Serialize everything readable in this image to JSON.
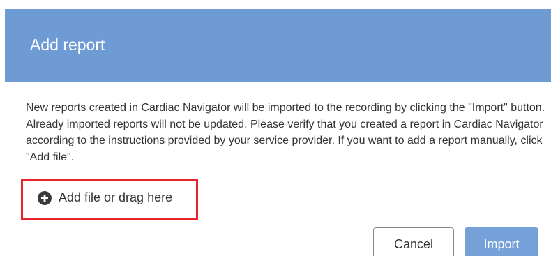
{
  "dialog": {
    "title": "Add report",
    "message": "New reports created in Cardiac Navigator will be imported to the recording by clicking the \"Import\" button. Already imported reports will not be updated. Please verify that you created a report in Cardiac Navigator according to the instructions provided by your service provider. If you want to add a report manually, click \"Add file\".",
    "add_file_label": "Add file or drag here",
    "add_file_icon": "plus-circle-icon",
    "cancel_label": "Cancel",
    "import_label": "Import"
  },
  "colors": {
    "header_bg": "#6f9bd4",
    "import_bg": "#76a0d8",
    "highlight_border": "#e8232a"
  }
}
